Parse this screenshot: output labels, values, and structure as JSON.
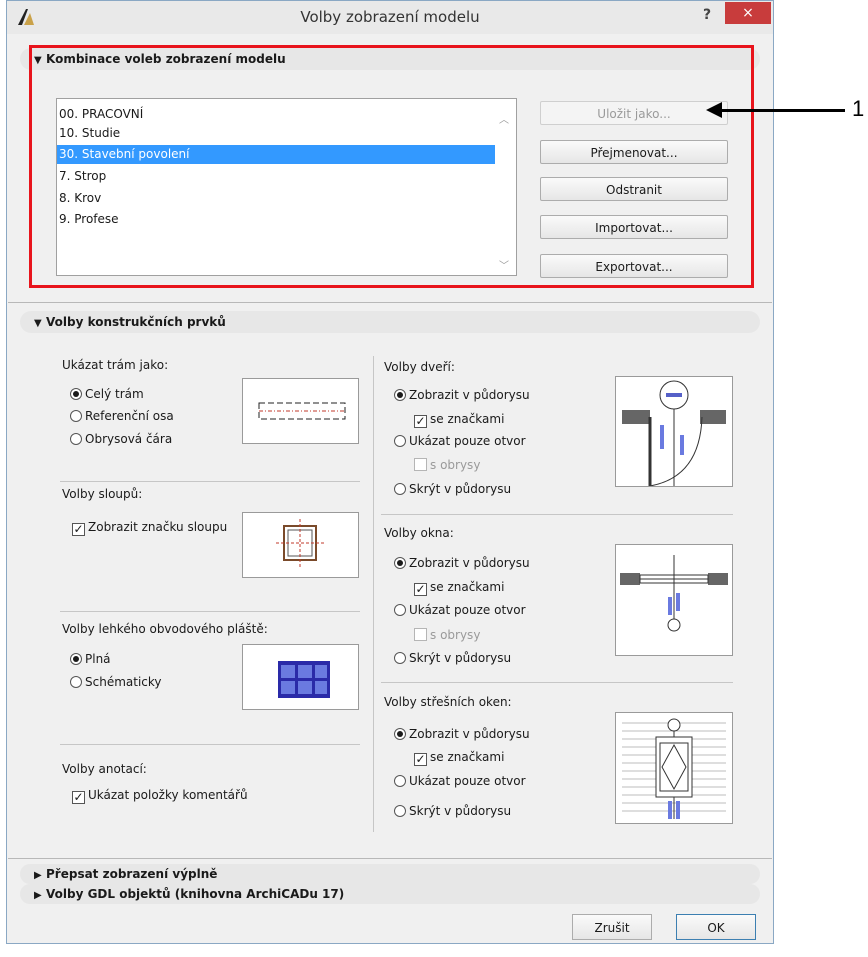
{
  "window": {
    "title": "Volby zobrazení modelu",
    "help": "?",
    "close": "×"
  },
  "section_model_combos": {
    "header": "Kombinace voleb zobrazení modelu",
    "items": [
      "00. PRACOVNÍ",
      "10. Studie",
      "30. Stavební povolení",
      "7. Strop",
      "8. Krov",
      "9. Profese"
    ],
    "selected": "30. Stavební povolení",
    "buttons": {
      "save_as": "Uložit jako...",
      "rename": "Přejmenovat...",
      "delete": "Odstranit",
      "import": "Importovat...",
      "export": "Exportovat..."
    }
  },
  "annotation": {
    "number": "1",
    "color": "#e8141c"
  },
  "section_construction": {
    "header": "Volby konstrukčních prvků",
    "beam": {
      "label": "Ukázat trám jako:",
      "options": [
        "Celý trám",
        "Referenční osa",
        "Obrysová čára"
      ],
      "selected": "Celý trám"
    },
    "column": {
      "label": "Volby sloupů:",
      "checkbox": "Zobrazit značku sloupu",
      "checked": true
    },
    "curtain_wall": {
      "label": "Volby lehkého obvodového pláště:",
      "options": [
        "Plná",
        "Schématicky"
      ],
      "selected": "Plná"
    },
    "annotations": {
      "label": "Volby anotací:",
      "checkbox": "Ukázat položky komentářů",
      "checked": true
    },
    "doors": {
      "label": "Volby dveří:",
      "show": "Zobrazit v půdorysu",
      "with_markers": "se značkami",
      "opening_only": "Ukázat pouze otvor",
      "with_outline": "s obrysy",
      "hide": "Skrýt v půdorysu"
    },
    "windows": {
      "label": "Volby okna:",
      "show": "Zobrazit v půdorysu",
      "with_markers": "se značkami",
      "opening_only": "Ukázat pouze otvor",
      "with_outline": "s obrysy",
      "hide": "Skrýt v půdorysu"
    },
    "roof_windows": {
      "label": "Volby střešních oken:",
      "show": "Zobrazit v půdorysu",
      "with_markers": "se značkami",
      "opening_only": "Ukázat pouze otvor",
      "hide": "Skrýt v půdorysu"
    }
  },
  "section_fill_override": {
    "header": "Přepsat zobrazení výplně"
  },
  "section_gdl": {
    "header": "Volby GDL objektů (knihovna ArchiCADu 17)"
  },
  "footer": {
    "cancel": "Zrušit",
    "ok": "OK"
  }
}
